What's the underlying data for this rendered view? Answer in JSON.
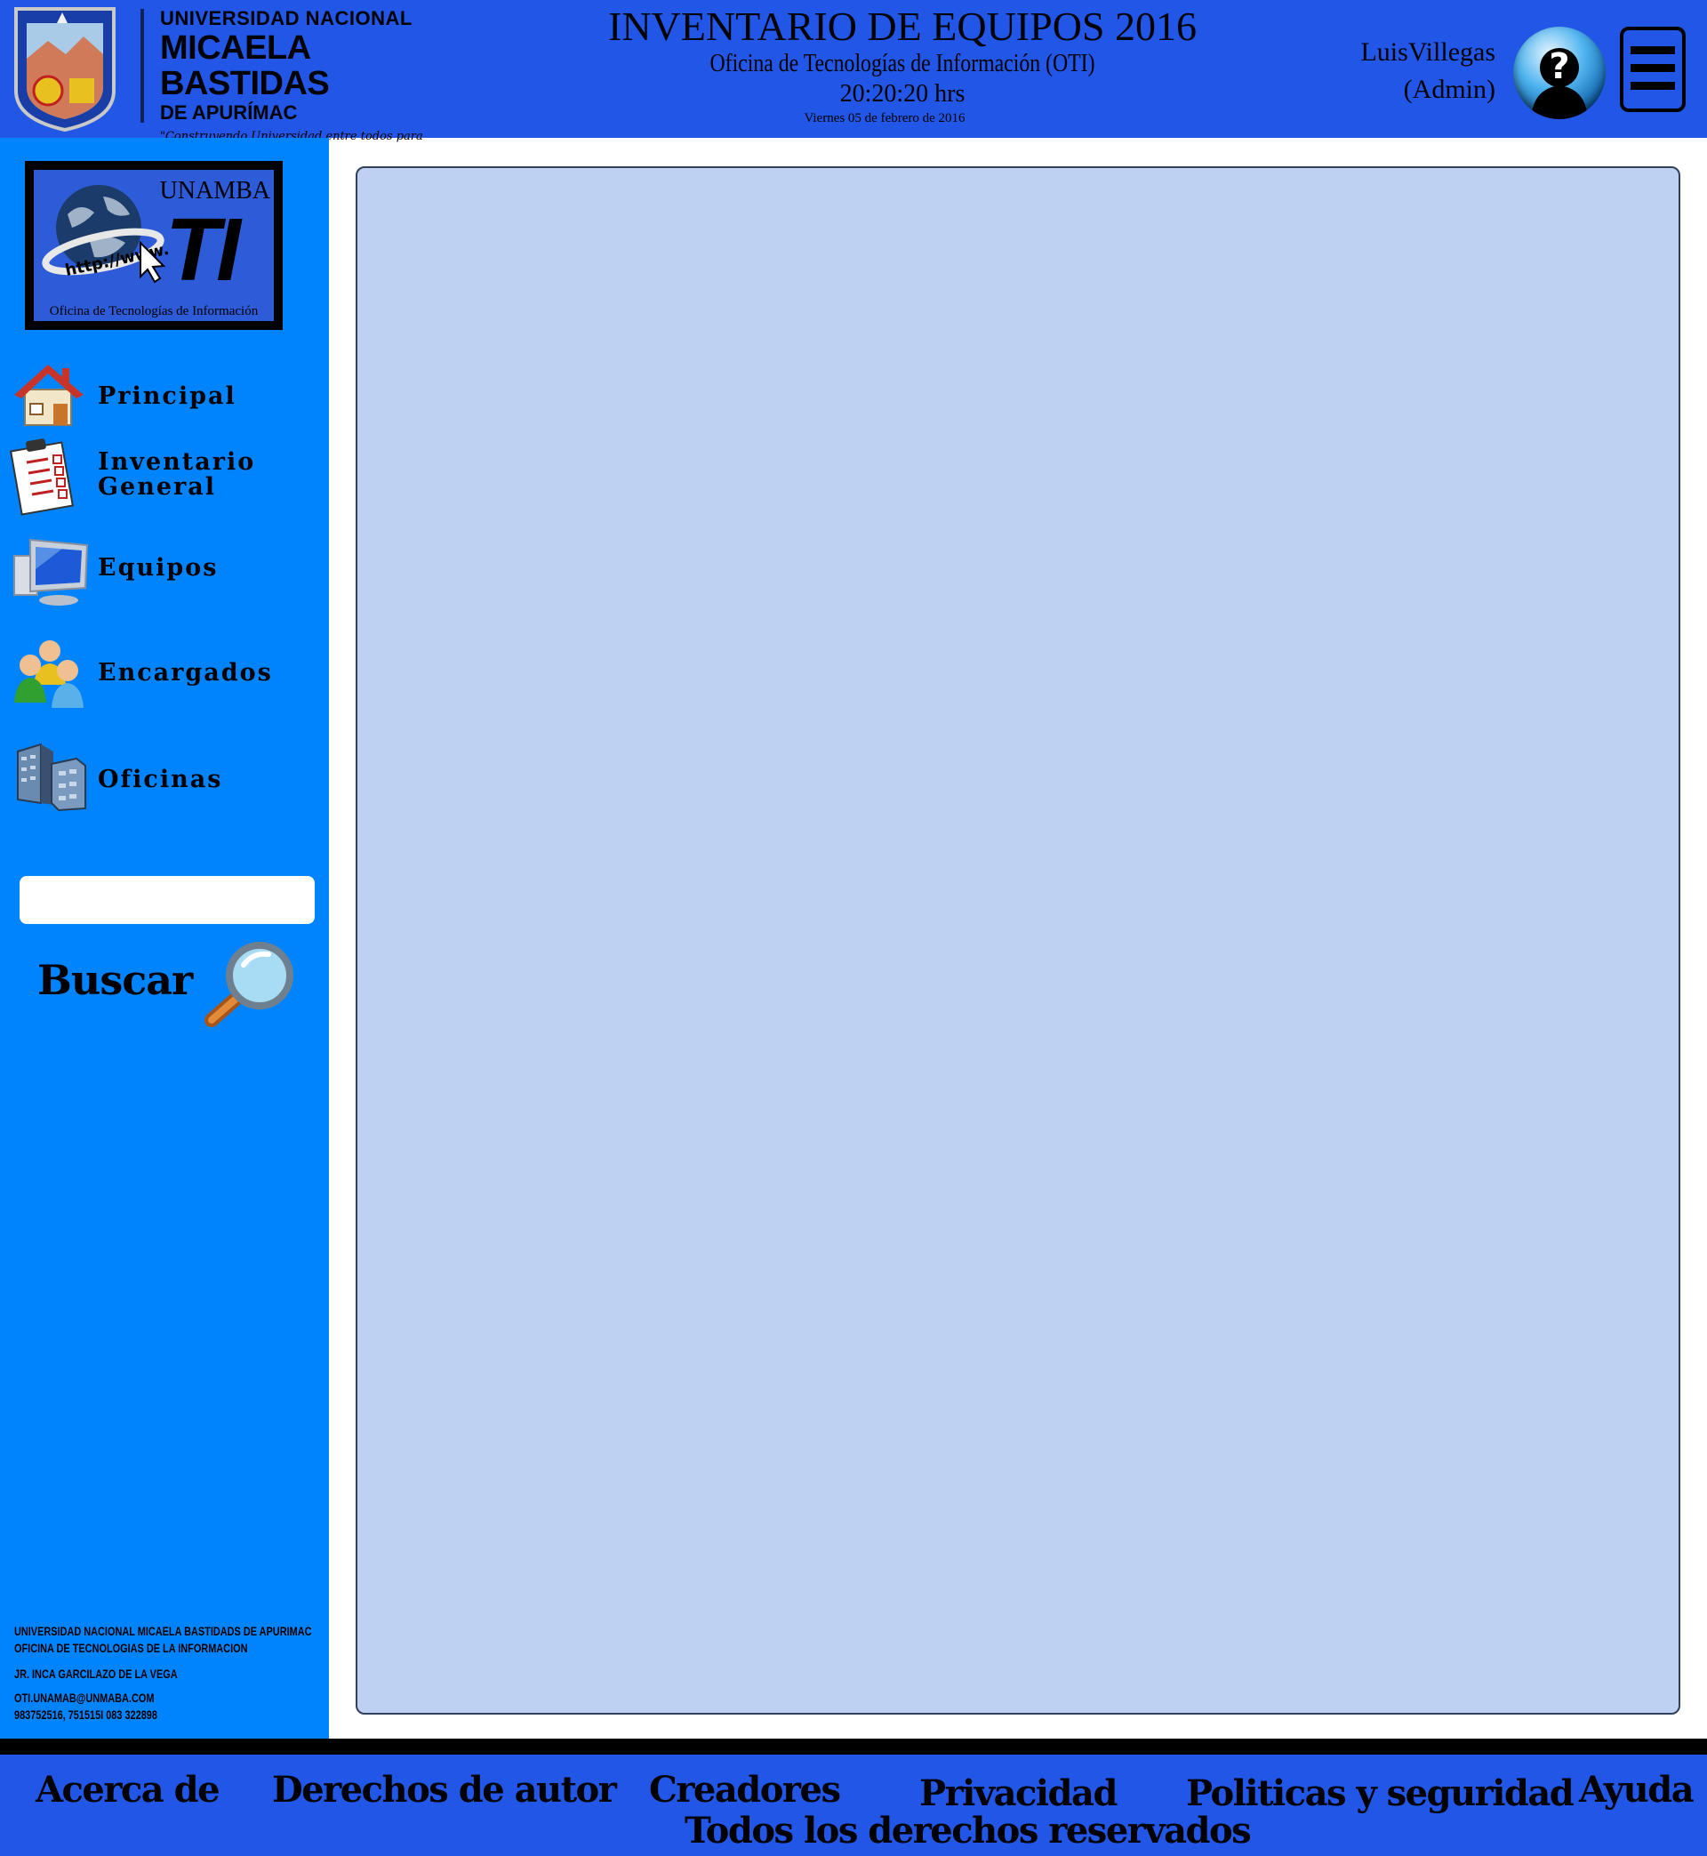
{
  "header": {
    "university": {
      "line1": "UNIVERSIDAD NACIONAL",
      "line2": "MICAELA BASTIDAS",
      "line3": "DE APURÍMAC",
      "motto": "\"Construyendo Universidad entre todos para todos\""
    },
    "title": "INVENTARIO DE EQUIPOS 2016",
    "subtitle": "Oficina de Tecnologías de Información (OTI)",
    "time": "20:20:20 hrs",
    "date": "Viernes 05 de febrero de 2016",
    "user": {
      "name": "LuisVillegas",
      "role": "(Admin)"
    },
    "help_icon": "help-question-icon",
    "menu_icon": "hamburger-menu-icon"
  },
  "sidebar": {
    "logo": {
      "top_text": "UNAMBA",
      "big_text": "TI",
      "url_text": "http://www.",
      "caption": "Oficina de Tecnologías de Información"
    },
    "nav": [
      {
        "label": "Principal",
        "icon": "house-icon"
      },
      {
        "label_line1": "Inventario",
        "label_line2": "General",
        "icon": "clipboard-checklist-icon"
      },
      {
        "label": "Equipos",
        "icon": "computer-monitor-icon"
      },
      {
        "label": "Encargados",
        "icon": "users-group-icon"
      },
      {
        "label": "Oficinas",
        "icon": "office-buildings-icon"
      }
    ],
    "search": {
      "value": "",
      "placeholder": "",
      "button_label": "Buscar",
      "icon": "magnifier-icon"
    },
    "footer_lines": [
      "UNIVERSIDAD NACIONAL MICAELA BASTIDADS DE APURIMAC",
      "OFICINA DE TECNOLOGIAS DE LA INFORMACION",
      "JR. INCA GARCILAZO DE LA VEGA",
      "OTI.UNAMAB@UNMABA.COM",
      "983752516, 751515I 083 322898"
    ]
  },
  "footer": {
    "links": [
      "Acerca de",
      "Derechos de autor",
      "Creadores",
      "Privacidad",
      "Politicas y seguridad",
      "Ayuda"
    ],
    "rights": "Todos los derechos reservados"
  },
  "colors": {
    "header_bg": "#2156e6",
    "sidebar_bg": "#0084fe",
    "panel_bg": "#bed1f2",
    "footer_bg": "#2156e6"
  }
}
